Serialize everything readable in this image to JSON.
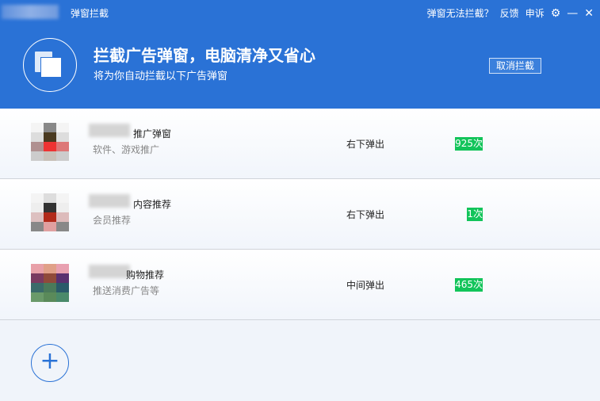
{
  "title_bar": {
    "app_title": "弹窗拦截",
    "cant_block": "弹窗无法拦截？",
    "feedback": "反馈",
    "appeal": "申诉"
  },
  "banner": {
    "headline": "拦截广告弹窗，电脑清净又省心",
    "subtitle": "将为你自动拦截以下广告弹窗",
    "cancel_button": "取消拦截"
  },
  "rows": [
    {
      "name": "推广弹窗",
      "desc": "软件、游戏推广",
      "position": "右下弹出",
      "count": "925次",
      "pixels": [
        "#f4f4f4",
        "#888",
        "#f4f4f4",
        "#ddd",
        "#4a3a20",
        "#ddd",
        "#b09090",
        "#e33",
        "#d77",
        "#ccc",
        "#c8c0b8",
        "#ccc"
      ]
    },
    {
      "name": "内容推荐",
      "desc": "会员推荐",
      "position": "右下弹出",
      "count": "1次",
      "pixels": [
        "#f4f4f4",
        "#ddd",
        "#f4f4f4",
        "#eee",
        "#333",
        "#eee",
        "#ddc0c0",
        "#b22a1a",
        "#dbb",
        "#888",
        "#e0a0a0",
        "#888"
      ]
    },
    {
      "name": "购物推荐",
      "desc": "推送消费广告等",
      "position": "中间弹出",
      "count": "465次",
      "pixels": [
        "#e8a0a8",
        "#e0a088",
        "#e8a0b0",
        "#7a3a60",
        "#904a3a",
        "#5a3070",
        "#3a6a6a",
        "#4a7a5a",
        "#2a5a6a",
        "#6a9a6a",
        "#5a8a5a",
        "#4a8a6a"
      ]
    }
  ],
  "colors": {
    "primary": "#2a72d6",
    "badge": "#12c45a"
  }
}
